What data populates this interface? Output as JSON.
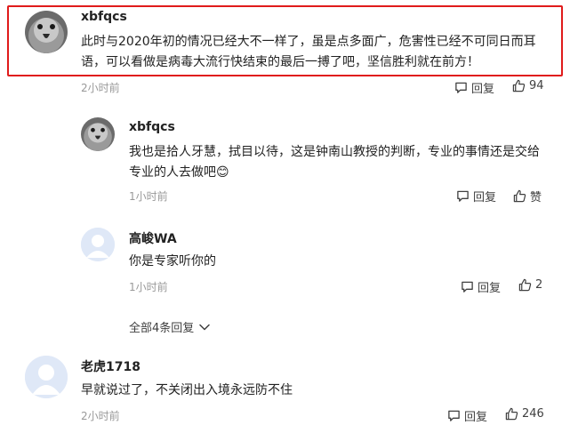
{
  "comments": [
    {
      "username": "xbfqcs",
      "text": "此时与2020年初的情况已经大不一样了，虽是点多面广，危害性已经不可同日而耳语，可以看做是病毒大流行快结束的最后一搏了吧，坚信胜利就在前方！",
      "time": "2小时前",
      "reply_label": "回复",
      "like_count": "94"
    },
    {
      "username": "xbfqcs",
      "text": "我也是拾人牙慧，拭目以待，这是钟南山教授的判断，专业的事情还是交给专业的人去做吧",
      "emoji": "😊",
      "time": "1小时前",
      "reply_label": "回复",
      "like_count": "赞"
    },
    {
      "username": "高峻WA",
      "text": "你是专家听你的",
      "time": "1小时前",
      "reply_label": "回复",
      "like_count": "2"
    },
    {
      "username": "老虎1718",
      "text": "早就说过了，不关闭出入境永远防不住",
      "time": "2小时前",
      "reply_label": "回复",
      "like_count": "246"
    }
  ],
  "expand_replies": "全部4条回复",
  "icons": {
    "reply": "comment-bubble-icon",
    "like": "thumbs-up-icon",
    "expand": "chevron-down-icon"
  },
  "colors": {
    "highlight": "#e01b1b",
    "meta": "#999999",
    "default_avatar_bg": "#dfe8f7",
    "default_avatar_fg": "#ffffff"
  }
}
